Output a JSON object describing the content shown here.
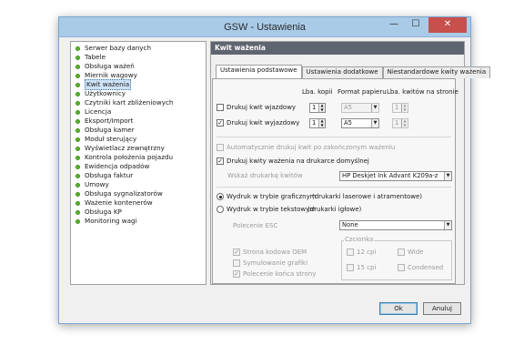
{
  "window": {
    "title": "GSW - Ustawienia",
    "min": "—",
    "max": "☐",
    "close": "✕"
  },
  "tree": {
    "items": [
      "Serwer bazy danych",
      "Tabele",
      "Obsługa ważeń",
      "Miernik wagowy",
      "Kwit ważenia",
      "Użytkownicy",
      "Czytniki kart zbliżeniowych",
      "Licencja",
      "Eksport/Import",
      "Obsługa kamer",
      "Moduł sterujący",
      "Wyświetlacz zewnętrzny",
      "Kontrola położenia pojazdu",
      "Ewidencja odpadów",
      "Obsługa faktur",
      "Umowy",
      "Obsługa sygnalizatorów",
      "Ważenie kontenerów",
      "Obsługa KP",
      "Monitoring wagi"
    ],
    "selected": "Kwit ważenia"
  },
  "panel": {
    "header": "Kwit ważenia"
  },
  "tabs": [
    "Ustawienia podstawowe",
    "Ustawienia dodatkowe",
    "Niestandardowe kwity ważenia"
  ],
  "columns": {
    "copies": "Lba. kopii",
    "paper": "Format papieru",
    "per_page": "Lba. kwitów na stronie"
  },
  "entry": {
    "label": "Drukuj kwit wjazdowy",
    "checked": false,
    "copies": "1",
    "paper": "A5",
    "per_page": "1"
  },
  "exit": {
    "label": "Drukuj kwit wyjazdowy",
    "checked": true,
    "copies": "1",
    "paper": "A5",
    "per_page": "1"
  },
  "auto_print": {
    "label": "Automatycznie drukuj kwit po zakończonym ważeniu",
    "checked": false
  },
  "default_printer": {
    "label": "Drukuj kwity ważenia na drukarce domyślnej",
    "checked": true
  },
  "printer": {
    "label": "Wskaż drukarkę kwitów",
    "value": "HP Deskjet Ink Advant K209a-z"
  },
  "mode": {
    "graphic_label": "Wydruk w trybie graficznym",
    "graphic_note": "(drukarki laserowe i atramentowe)",
    "text_label": "Wydruk w trybie tekstowym",
    "text_note": "(drukarki igłowe)",
    "selected": "graphic"
  },
  "esc": {
    "label": "Polecenie ESC",
    "value": "None"
  },
  "text_options": [
    {
      "label": "Strona kodowa OEM",
      "checked": true
    },
    {
      "label": "Symulowanie grafiki",
      "checked": false
    },
    {
      "label": "Polecenie końca strony",
      "checked": true
    }
  ],
  "font": {
    "title": "Czcionka",
    "options": [
      {
        "label": "12 cpi",
        "checked": false
      },
      {
        "label": "Wide",
        "checked": false
      },
      {
        "label": "15 cpi",
        "checked": false
      },
      {
        "label": "Condensed",
        "checked": false
      }
    ]
  },
  "buttons": {
    "ok": "Ok",
    "cancel": "Anuluj"
  },
  "glyphs": {
    "check": "✓",
    "up": "▲",
    "down": "▼"
  }
}
